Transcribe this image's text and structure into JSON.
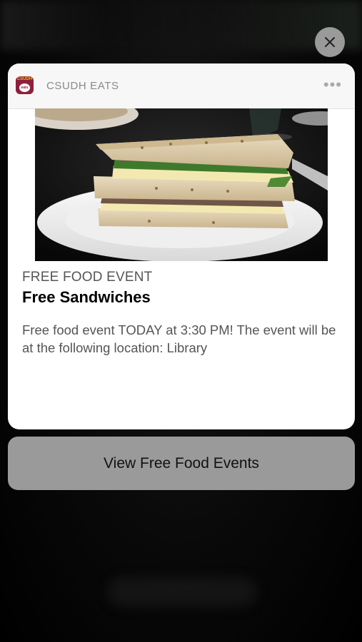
{
  "notification": {
    "app_name": "CSUDH EATS",
    "app_icon": {
      "name": "csudh-eats-app-icon",
      "top_text": "CSUDH",
      "plate_text": "eats",
      "background": "#8e1f3a",
      "accent": "#f4c400"
    },
    "more_icon": "ellipsis-icon",
    "more_label": "•••",
    "image": "sandwich-photo",
    "subtitle": "FREE FOOD EVENT",
    "title": "Free Sandwiches",
    "body": "Free food event TODAY at 3:30 PM! The event will be at the following location: Library"
  },
  "close_icon": "close-icon",
  "action": {
    "label": "View Free Food Events"
  },
  "colors": {
    "card_bg": "#ffffff",
    "header_bg": "#f7f7f7",
    "action_bg": "#9a9a9a",
    "close_bg": "#9a9a9a",
    "subtitle": "#555555",
    "app_name": "#8a8a8a"
  }
}
